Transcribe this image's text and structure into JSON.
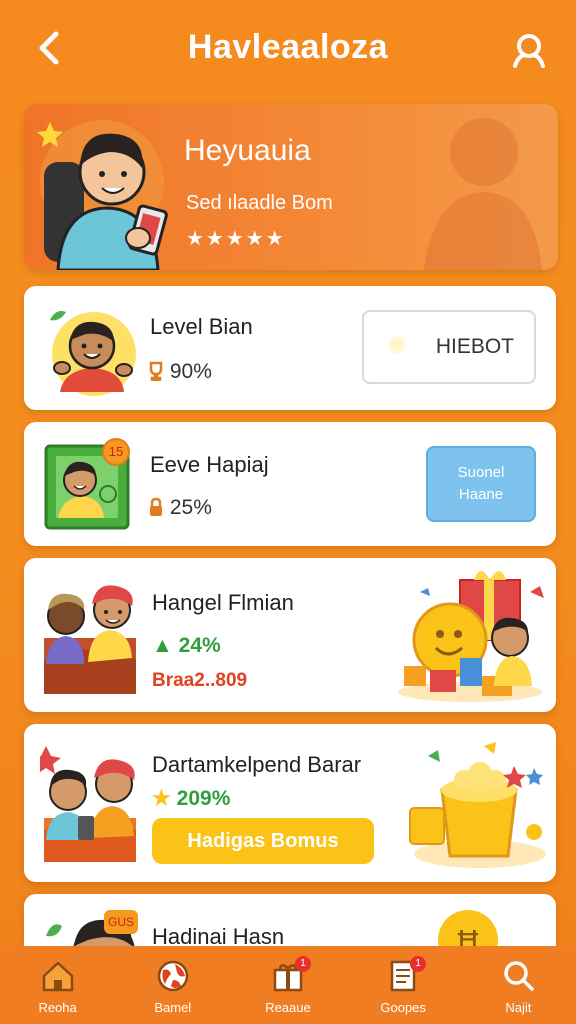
{
  "header": {
    "title": "Havleaaloza"
  },
  "hero": {
    "name": "Heyuauia",
    "subtitle": "Sed ılaadle Bom",
    "stars": "★★★★★"
  },
  "cards": [
    {
      "name": "Level Bian",
      "stat": "90%",
      "button": "HIEBOT"
    },
    {
      "name": "Eeve Hapiaj",
      "stat": "25%",
      "badge": "15",
      "button_line1": "Suonel",
      "button_line2": "Haane"
    },
    {
      "name": "Hangel Flmian",
      "stat": "24%",
      "sub": "Braa2..809"
    },
    {
      "name": "Dartamkelpend Barar",
      "stat": "209%",
      "button": "Hadigas Bomus"
    },
    {
      "name": "Hadinai Hasn",
      "badge": "GUS"
    }
  ],
  "tabbar": {
    "items": [
      {
        "label": "Reoha",
        "icon": "home-icon"
      },
      {
        "label": "Bamel",
        "icon": "globe-icon"
      },
      {
        "label": "Reaaue",
        "icon": "gift-icon",
        "badge": "1"
      },
      {
        "label": "Goopes",
        "icon": "document-icon",
        "badge": "1"
      },
      {
        "label": "Najit",
        "icon": "search-icon"
      }
    ]
  },
  "colors": {
    "background": "#f58a1f",
    "accent_green": "#2e9e3e",
    "accent_red": "#e0411f",
    "button_yellow": "#fbc318",
    "button_blue": "#7ec3ee"
  }
}
